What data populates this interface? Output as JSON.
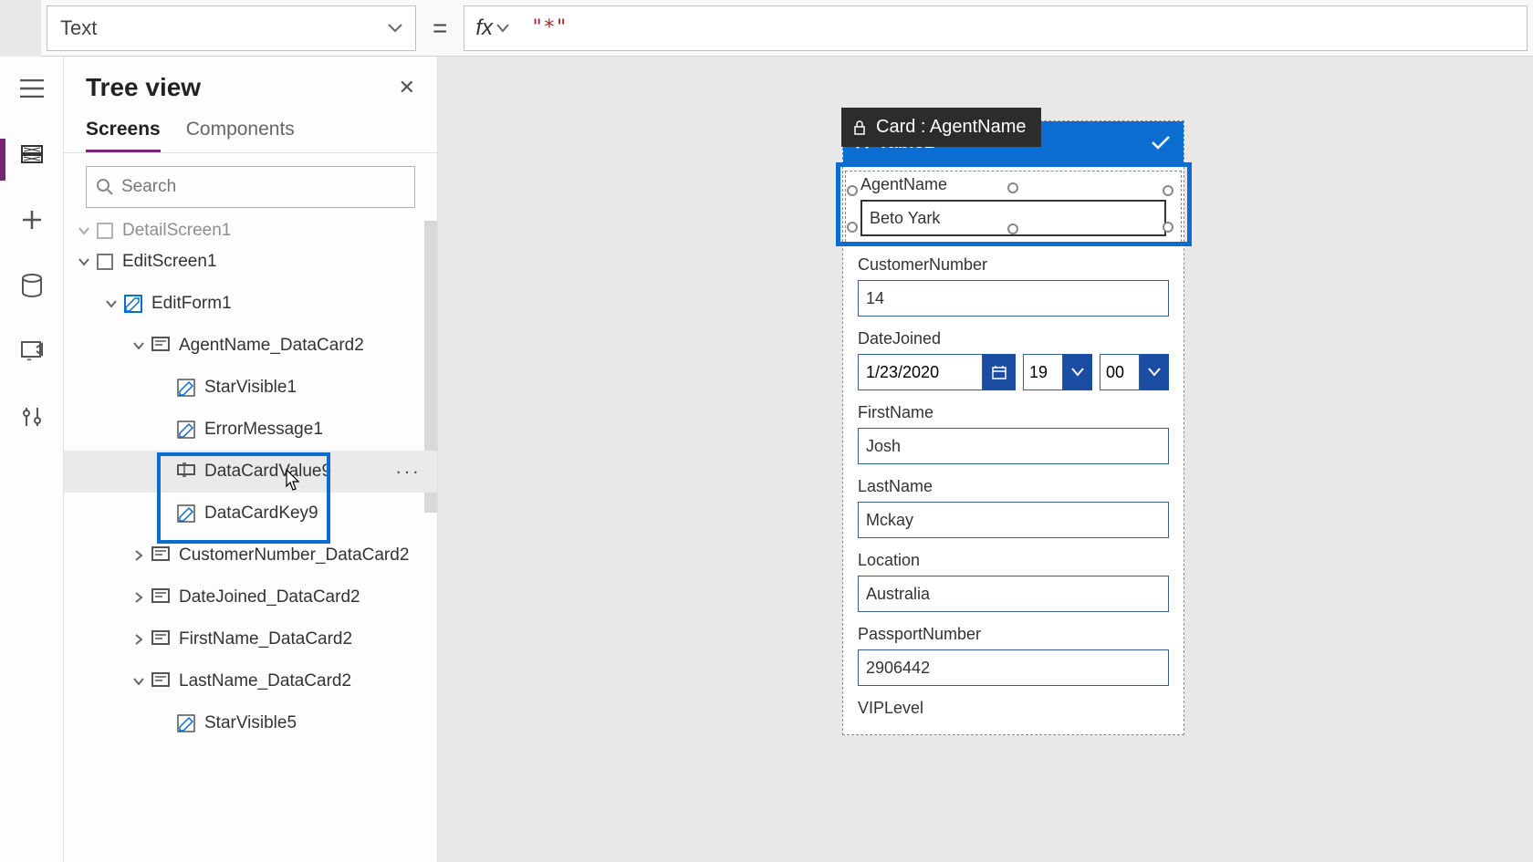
{
  "formula_bar": {
    "property": "Text",
    "fx_label": "fx",
    "expression": "\"*\""
  },
  "tree_panel": {
    "title": "Tree view",
    "tabs": {
      "screens": "Screens",
      "components": "Components"
    },
    "search_placeholder": "Search"
  },
  "tree": {
    "detailscreen": "DetailScreen1",
    "editscreen": "EditScreen1",
    "editform": "EditForm1",
    "agentname_card": "AgentName_DataCard2",
    "starvisible1": "StarVisible1",
    "errormessage1": "ErrorMessage1",
    "datacardvalue9": "DataCardValue9",
    "datacardkey9": "DataCardKey9",
    "customernumber_card": "CustomerNumber_DataCard2",
    "datejoined_card": "DateJoined_DataCard2",
    "firstname_card": "FirstName_DataCard2",
    "lastname_card": "LastName_DataCard2",
    "starvisible5": "StarVisible5"
  },
  "card": {
    "tag": "Card : AgentName",
    "header_title": "Table1",
    "fields": {
      "agentname": {
        "label": "AgentName",
        "value": "Beto Yark"
      },
      "customernumber": {
        "label": "CustomerNumber",
        "value": "14"
      },
      "datejoined": {
        "label": "DateJoined",
        "date": "1/23/2020",
        "hour": "19",
        "minute": "00"
      },
      "firstname": {
        "label": "FirstName",
        "value": "Josh"
      },
      "lastname": {
        "label": "LastName",
        "value": "Mckay"
      },
      "location": {
        "label": "Location",
        "value": "Australia"
      },
      "passportnumber": {
        "label": "PassportNumber",
        "value": "2906442"
      },
      "viplevel": {
        "label": "VIPLevel"
      }
    }
  }
}
